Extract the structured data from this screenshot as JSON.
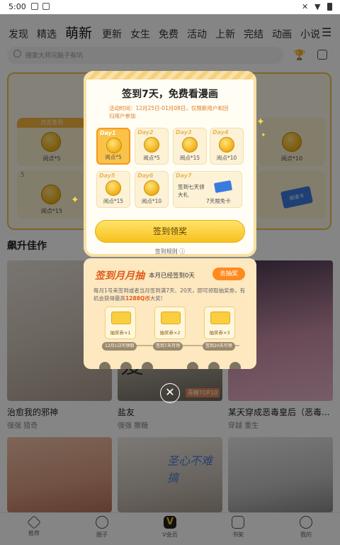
{
  "status_bar": {
    "time": "5:00"
  },
  "top_nav": {
    "tabs": [
      "发现",
      "精选",
      "萌新",
      "更新",
      "女生",
      "免费",
      "活动",
      "上新",
      "完结",
      "动画",
      "小说"
    ],
    "active_index": 2
  },
  "search": {
    "placeholder": "搜家大师兄脑子有坑"
  },
  "bg_signin": {
    "days": [
      {
        "label": "点击签到",
        "reward": "阅点*5"
      },
      {
        "label": "",
        "reward": "阅点*10"
      },
      {
        "label": "5",
        "reward": "阅点*15"
      },
      {
        "label": "",
        "reward": "阅读卡"
      }
    ]
  },
  "section": {
    "title": "飙升佳作"
  },
  "comics": [
    {
      "title": "治愈我的邪神",
      "tags": "强强 猎奇"
    },
    {
      "title": "盐友",
      "tags": "强强 撒糖",
      "badge": "青糖TOP10"
    },
    {
      "title": "某天穿成恶毒皇后（恶毒...",
      "tags": "穿越 重生"
    },
    {
      "title": "",
      "tags": ""
    },
    {
      "title": "",
      "tags": "",
      "cover_text": "圣心不难搞"
    },
    {
      "title": "",
      "tags": ""
    }
  ],
  "tabbar": {
    "items": [
      "推荐",
      "圈子",
      "V会员",
      "书架",
      "我的"
    ],
    "active_index": 0
  },
  "popup": {
    "title": "签到7天，免费看漫画",
    "desc": "活动时间：12月25日-01月08日，仅限新用户和回归用户参加",
    "days": [
      {
        "day": "Day1",
        "reward": "阅点*5",
        "active": true
      },
      {
        "day": "Day2",
        "reward": "阅点*5",
        "active": false
      },
      {
        "day": "Day3",
        "reward": "阅点*15",
        "active": false
      },
      {
        "day": "Day4",
        "reward": "阅点*10",
        "active": false
      },
      {
        "day": "Day5",
        "reward": "阅点*15",
        "active": false
      },
      {
        "day": "Day6",
        "reward": "阅点*10",
        "active": false
      }
    ],
    "day7": {
      "day": "Day7",
      "text": "签到七天领大礼",
      "reward": "7天限免卡"
    },
    "button": "签到领奖",
    "rules": "签到规则"
  },
  "lottery": {
    "title": "签到月月抽",
    "status": "本月已经签到0天",
    "button": "去抽奖",
    "desc_prefix": "每月1号来签到或者当月签到满7天、20天，即可领取抽奖券，有机会获得最高",
    "desc_highlight": "1288Q币",
    "desc_suffix": "大奖!",
    "tickets": [
      "抽奖券×1",
      "抽奖券×2",
      "抽奖券×3"
    ],
    "dates": [
      "12月1日可领取",
      "签到7天可领",
      "签到20天可领"
    ]
  }
}
